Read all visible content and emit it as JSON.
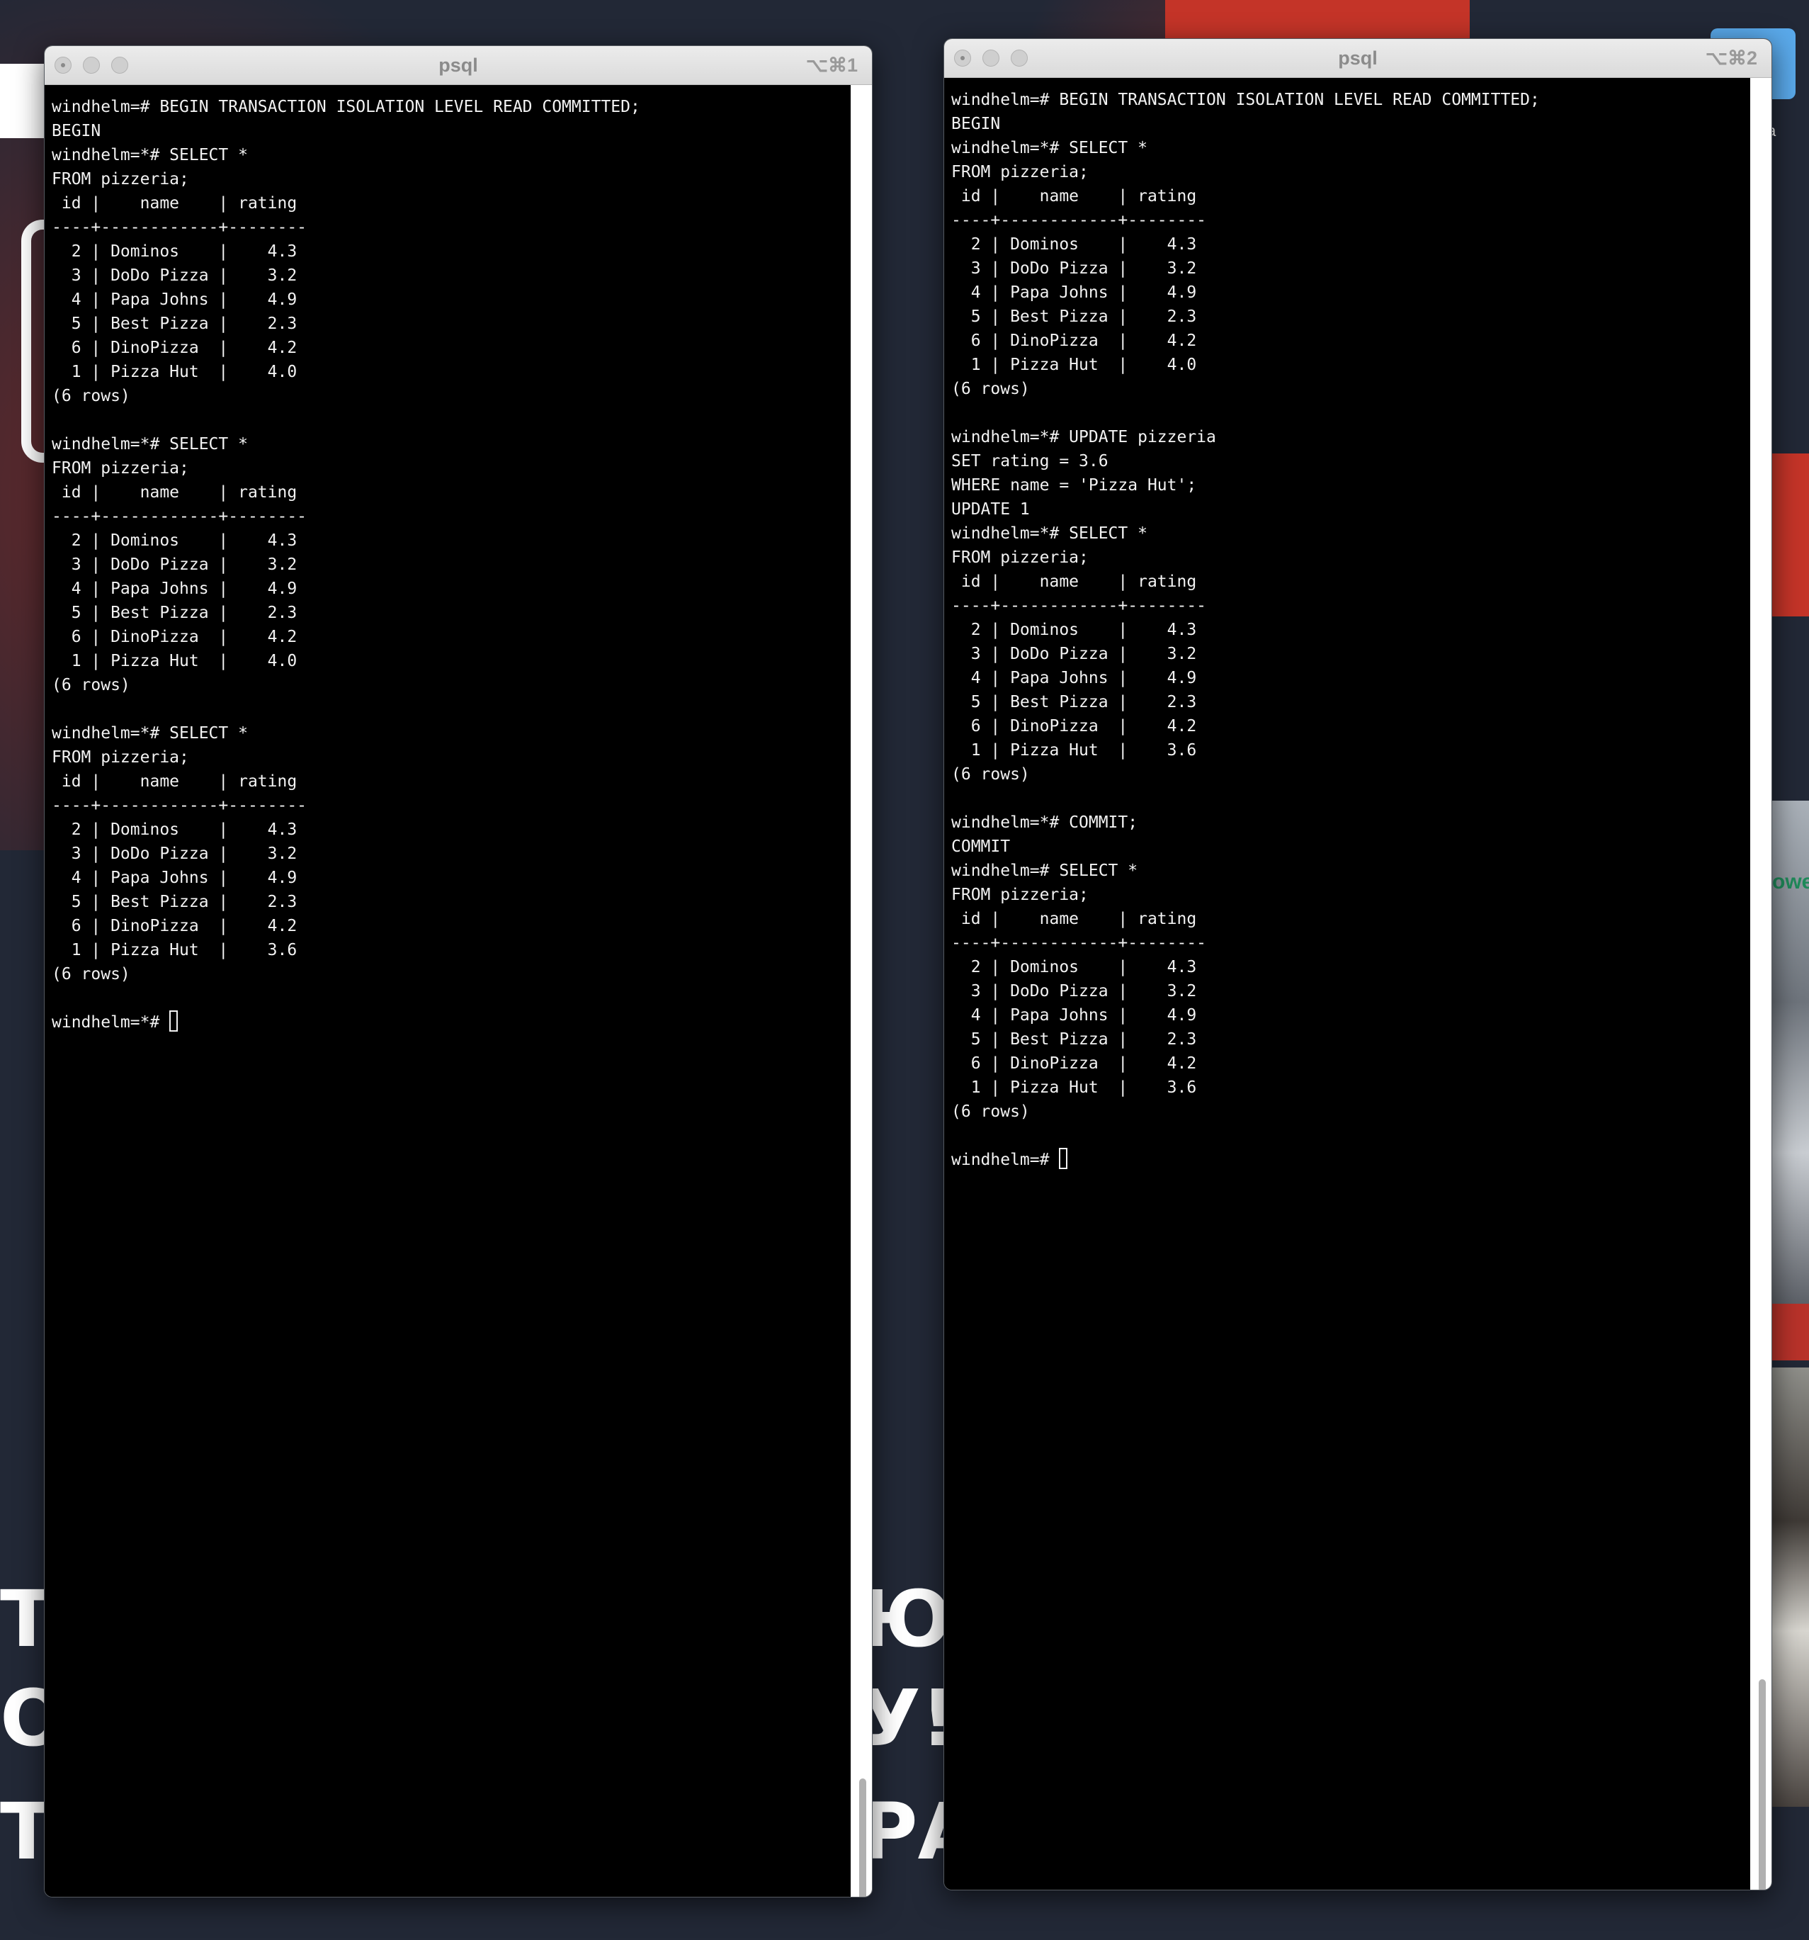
{
  "background": {
    "big_text": [
      "ТЛ",
      "О",
      "Т",
      "Ю",
      "У!",
      "РА"
    ],
    "photo_text": "owe",
    "folder_label": "a"
  },
  "windows": [
    {
      "title": "psql",
      "shortcut": "⌥⌘1",
      "lines": [
        "windhelm=# BEGIN TRANSACTION ISOLATION LEVEL READ COMMITTED;",
        "BEGIN",
        "windhelm=*# SELECT *",
        "FROM pizzeria;",
        " id |    name    | rating",
        "----+------------+--------",
        "  2 | Dominos    |    4.3",
        "  3 | DoDo Pizza |    3.2",
        "  4 | Papa Johns |    4.9",
        "  5 | Best Pizza |    2.3",
        "  6 | DinoPizza  |    4.2",
        "  1 | Pizza Hut  |    4.0",
        "(6 rows)",
        "",
        "windhelm=*# SELECT *",
        "FROM pizzeria;",
        " id |    name    | rating",
        "----+------------+--------",
        "  2 | Dominos    |    4.3",
        "  3 | DoDo Pizza |    3.2",
        "  4 | Papa Johns |    4.9",
        "  5 | Best Pizza |    2.3",
        "  6 | DinoPizza  |    4.2",
        "  1 | Pizza Hut  |    4.0",
        "(6 rows)",
        "",
        "windhelm=*# SELECT *",
        "FROM pizzeria;",
        " id |    name    | rating",
        "----+------------+--------",
        "  2 | Dominos    |    4.3",
        "  3 | DoDo Pizza |    3.2",
        "  4 | Papa Johns |    4.9",
        "  5 | Best Pizza |    2.3",
        "  6 | DinoPizza  |    4.2",
        "  1 | Pizza Hut  |    3.6",
        "(6 rows)",
        ""
      ],
      "prompt": "windhelm=*# "
    },
    {
      "title": "psql",
      "shortcut": "⌥⌘2",
      "lines": [
        "windhelm=# BEGIN TRANSACTION ISOLATION LEVEL READ COMMITTED;",
        "BEGIN",
        "windhelm=*# SELECT *",
        "FROM pizzeria;",
        " id |    name    | rating",
        "----+------------+--------",
        "  2 | Dominos    |    4.3",
        "  3 | DoDo Pizza |    3.2",
        "  4 | Papa Johns |    4.9",
        "  5 | Best Pizza |    2.3",
        "  6 | DinoPizza  |    4.2",
        "  1 | Pizza Hut  |    4.0",
        "(6 rows)",
        "",
        "windhelm=*# UPDATE pizzeria",
        "SET rating = 3.6",
        "WHERE name = 'Pizza Hut';",
        "UPDATE 1",
        "windhelm=*# SELECT *",
        "FROM pizzeria;",
        " id |    name    | rating",
        "----+------------+--------",
        "  2 | Dominos    |    4.3",
        "  3 | DoDo Pizza |    3.2",
        "  4 | Papa Johns |    4.9",
        "  5 | Best Pizza |    2.3",
        "  6 | DinoPizza  |    4.2",
        "  1 | Pizza Hut  |    3.6",
        "(6 rows)",
        "",
        "windhelm=*# COMMIT;",
        "COMMIT",
        "windhelm=# SELECT *",
        "FROM pizzeria;",
        " id |    name    | rating",
        "----+------------+--------",
        "  2 | Dominos    |    4.3",
        "  3 | DoDo Pizza |    3.2",
        "  4 | Papa Johns |    4.9",
        "  5 | Best Pizza |    2.3",
        "  6 | DinoPizza  |    4.2",
        "  1 | Pizza Hut  |    3.6",
        "(6 rows)",
        ""
      ],
      "prompt": "windhelm=# "
    }
  ]
}
